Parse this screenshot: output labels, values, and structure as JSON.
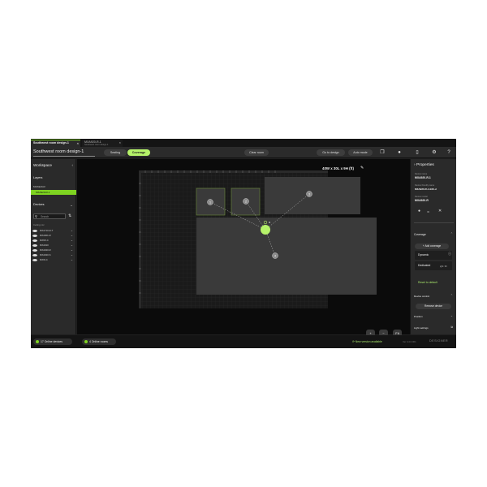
{
  "tabs": [
    {
      "label": "Southwest room design-1",
      "active": true
    },
    {
      "label": "MXA920-R-1",
      "sublabel": "Southwest room design-1",
      "active": false
    }
  ],
  "toolbar": {
    "design_name": "Southwest room design-1",
    "mode_seating": "Seating",
    "mode_coverage": "Coverage",
    "clear_room": "Clear room",
    "go_to_design": "Go to design",
    "auto_mode": "Auto mode"
  },
  "sidebar": {
    "workspace": "Workspace",
    "layers": "Layers",
    "layer_items": [
      {
        "label": "MXA920-R",
        "selected": false
      },
      {
        "label": "MXA920-R-1",
        "selected": true
      }
    ],
    "devices": "Devices",
    "search_placeholder": "Search",
    "section_label": "Ceiling mic",
    "device_items": [
      "MXA710-R-T",
      "MXA901-R",
      "MXN5-C",
      "MXA910",
      "MXA920-R",
      "MXA920-S",
      "MXW-C"
    ]
  },
  "canvas": {
    "dimensions": "40W x 30L x 9H (ft)",
    "numbered_markers": [
      "1",
      "2",
      "3",
      "4"
    ]
  },
  "properties": {
    "title": "Properties",
    "device_name_label": "Device name",
    "device_name": "MXA920-R-1",
    "friendly_name_label": "Device friendly name",
    "friendly_name": "MXA920-R-1-E23-d",
    "device_model_label": "Device model",
    "device_model": "MXA920-R",
    "coverage": "Coverage",
    "add_coverage": "+ Add coverage",
    "dynamic": "Dynamic",
    "dedicated": "Dedicated",
    "dedicated_note": "ight: 3ft",
    "reset_default": "Reset to default",
    "device_control": "Device control",
    "remove_device": "Remove device",
    "position": "Position",
    "light_settings": "Light settings"
  },
  "statusbar": {
    "online_devices": "17 Online devices",
    "online_rooms": "4 Online rooms",
    "new_version": "New version available",
    "version_text": "Ver 4.4.0.001",
    "brand": "DESIGNER"
  },
  "zoom": {
    "zoom_in": "+",
    "zoom_out": "−",
    "fit": "Fit"
  },
  "colors": {
    "accent": "#7ed321",
    "canvas_bg": "#0b0b0b",
    "panel_bg": "#2a2a2a"
  }
}
